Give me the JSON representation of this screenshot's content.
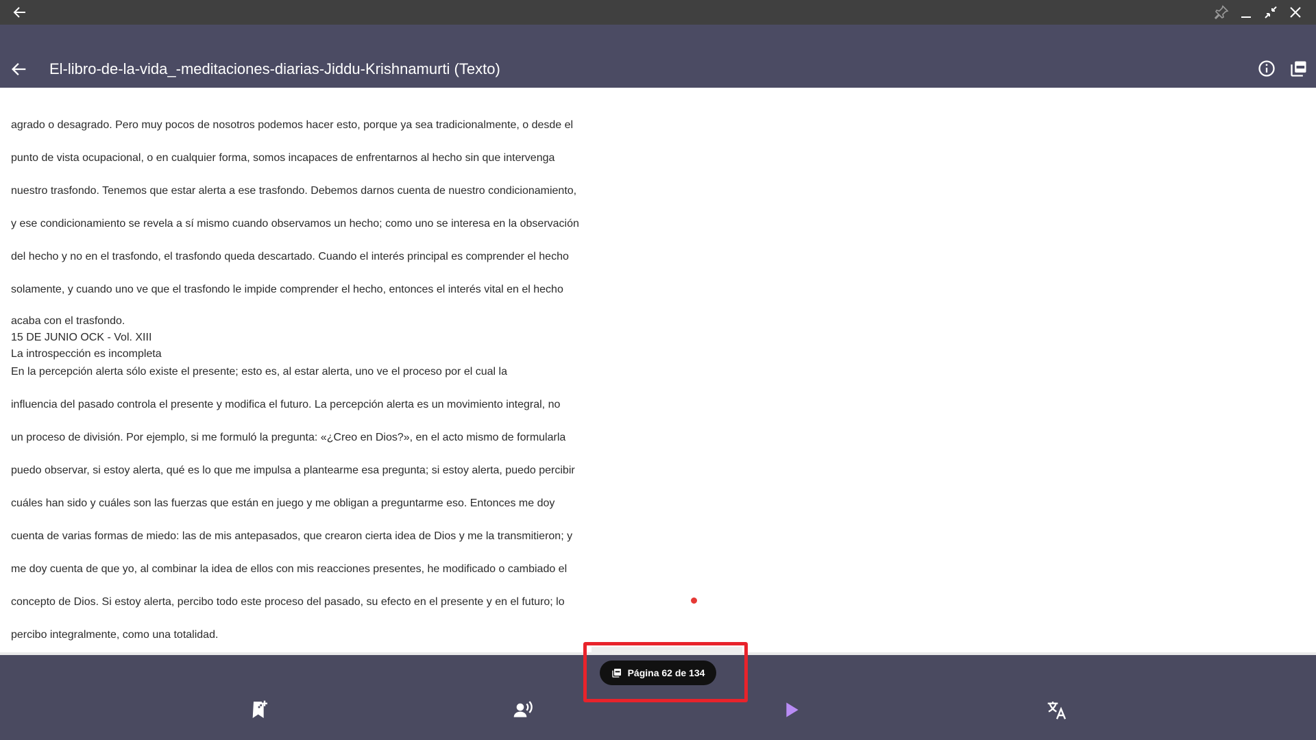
{
  "window": {
    "back_icon": "arrow-left-icon",
    "controls": [
      "pin-icon",
      "minimize-icon",
      "restore-icon",
      "close-icon"
    ]
  },
  "appbar": {
    "title": "El-libro-de-la-vida_-meditaciones-diarias-Jiddu-Krishnamurti (Texto)",
    "back_icon": "arrow-left-icon",
    "info_icon": "info-icon",
    "pdf_icon": "pdf-icon"
  },
  "content": {
    "lines": [
      "agrado o desagrado. Pero muy pocos de nosotros podemos hacer esto, porque ya sea tradicionalmente, o desde el",
      "punto de vista ocupacional, o en cualquier forma, somos incapaces de enfrentarnos al hecho sin que intervenga",
      "nuestro trasfondo. Tenemos que estar alerta a ese trasfondo. Debemos darnos cuenta de nuestro condicionamiento,",
      "y ese condicionamiento se revela a sí mismo cuando observamos un hecho; como uno se interesa en la observación",
      "del hecho y no en el trasfondo, el trasfondo queda descartado. Cuando el interés principal es comprender el hecho",
      "solamente, y cuando uno ve que el trasfondo le impide comprender el hecho, entonces el interés vital en el hecho",
      "acaba con el trasfondo.",
      "15 DE JUNIO OCK - Vol. XIII",
      "La introspección es incompleta",
      "En la percepción alerta sólo existe el presente; esto es, al estar alerta, uno ve el proceso por el cual la",
      "influencia del pasado controla el presente y modifica el futuro. La percepción alerta es un movimiento integral, no",
      "un proceso de división. Por ejemplo, si me formuló la pregunta: «¿Creo en Dios?», en el acto mismo de formularla",
      "puedo observar, si estoy alerta, qué es lo que me impulsa a plantearme esa pregunta; si estoy alerta, puedo percibir",
      "cuáles han sido y cuáles son las fuerzas que están en juego y me obligan a preguntarme eso. Entonces me doy",
      "cuenta de varias formas de miedo: las de mis antepasados, que crearon cierta idea de Dios y me la transmitieron; y",
      "me doy cuenta de que yo, al combinar la idea de ellos con mis reacciones presentes, he modificado o cambiado el",
      "concepto de Dios. Si estoy alerta, percibo todo este proceso del pasado, su efecto en el presente y en el futuro; lo",
      "percibo integralmente, como una totalidad."
    ]
  },
  "pager": {
    "label": "Página 62 de 134",
    "icon": "pages-icon"
  },
  "bottom_nav": [
    {
      "name": "bookmark-add-button",
      "icon": "bookmark-add-icon"
    },
    {
      "name": "voice-button",
      "icon": "record-voice-icon"
    },
    {
      "name": "play-button",
      "icon": "play-icon"
    },
    {
      "name": "translate-button",
      "icon": "translate-icon"
    }
  ],
  "colors": {
    "window_bar": "#404040",
    "app_bar": "#4b4b63",
    "bottom_bar": "#4a4a60",
    "play_accent": "#b98cf5",
    "highlight_border": "#e8232b",
    "pager_bg": "#111111"
  }
}
